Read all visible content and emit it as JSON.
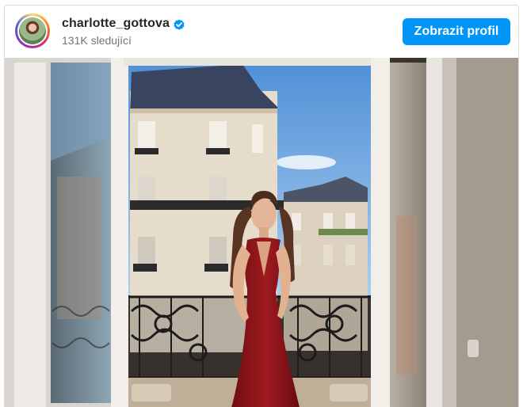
{
  "post": {
    "username": "charlotte_gottova",
    "followers": "131K sledující",
    "verified": true,
    "view_profile_label": "Zobrazit profil",
    "avatar_icon": "profile-avatar",
    "verified_icon": "verified-badge-icon"
  },
  "colors": {
    "accent": "#0095f6",
    "username": "#262626",
    "muted": "#737373",
    "border": "#dbdbdb"
  }
}
